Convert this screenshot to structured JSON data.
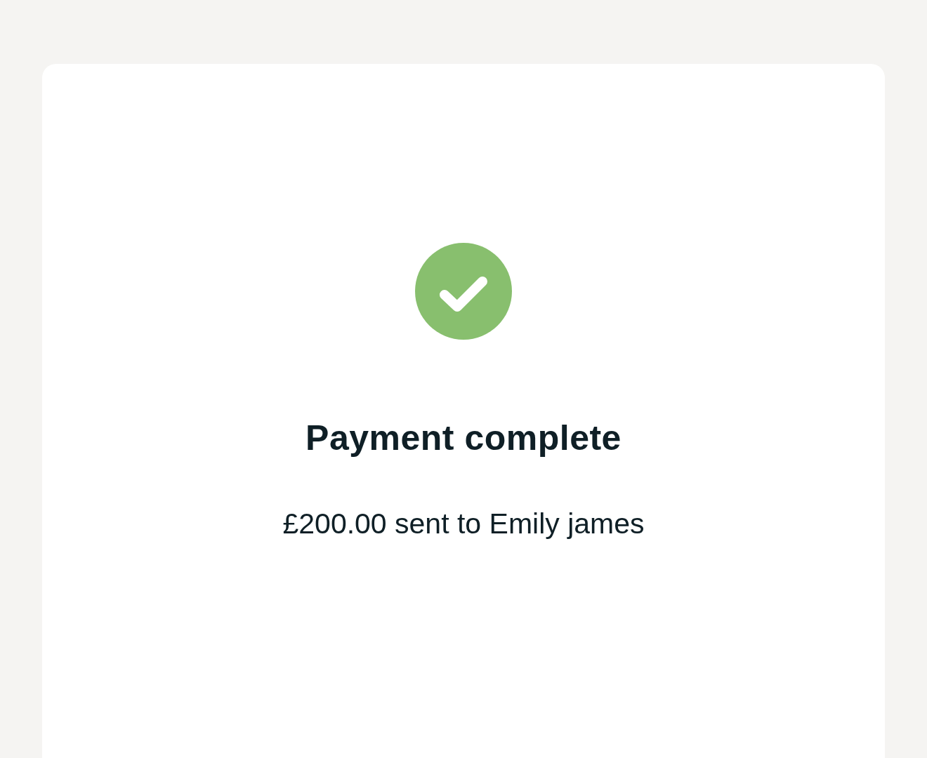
{
  "title": "Payment complete",
  "message": "£200.00 sent to Emily james"
}
